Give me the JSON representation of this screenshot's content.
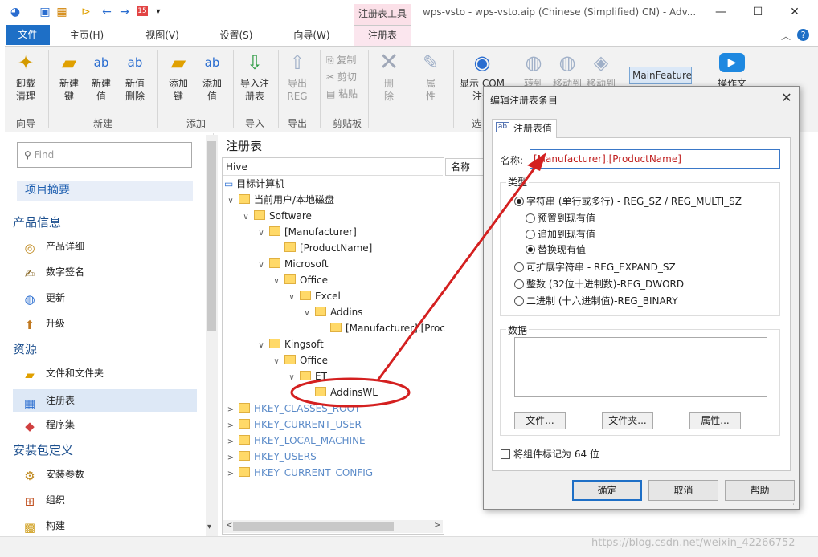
{
  "titlebar": {
    "context_tab": "注册表工具",
    "title": "wps-vsto - wps-vsto.aip (Chinese (Simplified) CN) - Adv...",
    "badge": "15"
  },
  "menu": {
    "file": "文件",
    "tabs": [
      "主页(H)",
      "视图(V)",
      "设置(S)",
      "向导(W)",
      "注册表"
    ]
  },
  "ribbon": {
    "uninstall": "卸载\n清理",
    "new_key": "新建\n键",
    "new_value": "新建\n值",
    "new_value_del": "新值\n删除",
    "add_key": "添加\n键",
    "add_value": "添加\n值",
    "import": "导入注\n册表",
    "export": "导出\nREG",
    "copy": "复制",
    "cut": "剪切",
    "paste": "粘贴",
    "delete": "删\n除",
    "props": "属\n性",
    "show_com": "显示 COM\n注册",
    "conv": "转到",
    "move1": "移动到",
    "move2": "移动到",
    "mainfeature": "MainFeature",
    "video": "操作文",
    "groups": [
      "向导",
      "新建",
      "添加",
      "导入",
      "导出",
      "剪贴板",
      "选"
    ]
  },
  "left": {
    "find_placeholder": "Find",
    "summary": "项目摘要",
    "sec_product": "产品信息",
    "product_details": "产品详细",
    "digital_sign": "数字签名",
    "update": "更新",
    "upgrade": "升级",
    "sec_resources": "资源",
    "files_folders": "文件和文件夹",
    "registry": "注册表",
    "assemblies": "程序集",
    "sec_package": "安装包定义",
    "install_params": "安装参数",
    "organization": "组织",
    "build": "构建"
  },
  "middle": {
    "title": "注册表",
    "hive": "Hive",
    "names_header": "名称",
    "tree": [
      "目标计算机",
      "当前用户/本地磁盘",
      "Software",
      "[Manufacturer]",
      "[ProductName]",
      "Microsoft",
      "Office",
      "Excel",
      "Addins",
      "[Manufacturer].[Proc",
      "Kingsoft",
      "Office",
      "ET",
      "AddinsWL",
      "HKEY_CLASSES_ROOT",
      "HKEY_CURRENT_USER",
      "HKEY_LOCAL_MACHINE",
      "HKEY_USERS",
      "HKEY_CURRENT_CONFIG"
    ]
  },
  "dialog": {
    "title": "编辑注册表条目",
    "tab": "注册表值",
    "tab_icon": "ab",
    "name_label": "名称:",
    "name_value": "[Manufacturer].[ProductName]",
    "type_label": "类型",
    "opt_string": "字符串 (单行或多行) - REG_SZ / REG_MULTI_SZ",
    "opt_prepend": "预置到现有值",
    "opt_append": "追加到现有值",
    "opt_replace": "替换现有值",
    "opt_expand": "可扩展字符串 - REG_EXPAND_SZ",
    "opt_dword": "整数 (32位十进制数)-REG_DWORD",
    "opt_binary": "二进制 (十六进制值)-REG_BINARY",
    "data_label": "数据",
    "btn_file": "文件...",
    "btn_folder": "文件夹...",
    "btn_prop": "属性...",
    "chk64": "将组件标记为 64 位",
    "ok": "确定",
    "cancel": "取消",
    "help": "帮助"
  },
  "watermark": "https://blog.csdn.net/weixin_42266752",
  "colors": {
    "accent": "#1e6fc6",
    "annotation": "#d42020"
  }
}
